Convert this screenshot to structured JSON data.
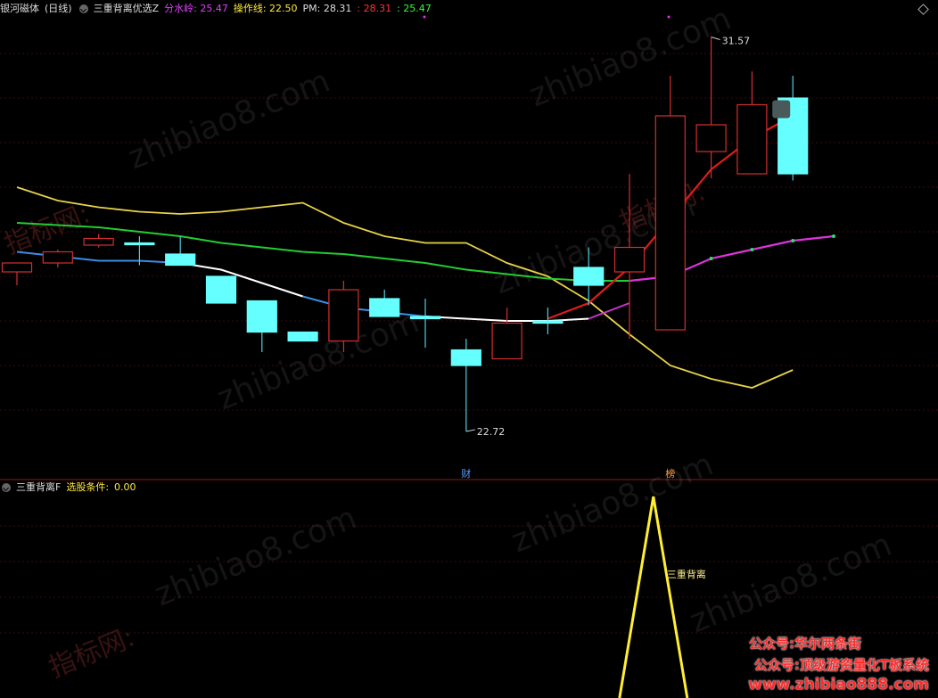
{
  "main_panel": {
    "stock_name": "银河磁体",
    "period": "(日线)",
    "indicator": "三重背离优选Z",
    "indicators": [
      {
        "label": "分水岭:",
        "value": "25.47",
        "color": "#e040fb"
      },
      {
        "label": "操作线:",
        "value": "22.50",
        "color": "#ffeb3b"
      },
      {
        "label": "PM:",
        "value": "28.31",
        "color": "#dddddd"
      },
      {
        "label": ":",
        "value": "28.31",
        "color": "#ff3333"
      },
      {
        "label": ":",
        "value": "25.47",
        "color": "#33ff33"
      }
    ],
    "high_label": "31.57",
    "low_label": "22.72",
    "marker_cai": "财",
    "marker_bang": "榜"
  },
  "sub_panel": {
    "indicator": "三重背离F",
    "condition_label": "选股条件:",
    "condition_value": "0.00",
    "signal_label": "三重背离"
  },
  "watermarks": {
    "site": "zhibiao8.com",
    "cn": "指标网:",
    "mid_glyph": "■"
  },
  "promos": {
    "line1": "公众号:华尔两条街",
    "line2": "公众号:顶级游资量化T板系统",
    "line3": "www.zhibiao888.com"
  },
  "colors": {
    "up": "#d32f2f",
    "down": "#4dd0e1",
    "down_fill": "#66ffff",
    "ma_yellow": "#e8d24a",
    "ma_green": "#22cc33",
    "ma_blue": "#3a8ee6",
    "grid": "#3a0a0a"
  },
  "chart_data": {
    "type": "candlestick",
    "candles": [
      {
        "o": 26.3,
        "h": 26.5,
        "l": 26.0,
        "c": 26.5,
        "up": true
      },
      {
        "o": 26.5,
        "h": 26.8,
        "l": 26.4,
        "c": 26.75,
        "up": true
      },
      {
        "o": 26.9,
        "h": 27.15,
        "l": 26.85,
        "c": 27.05,
        "up": true
      },
      {
        "o": 26.95,
        "h": 27.1,
        "l": 26.45,
        "c": 26.95,
        "up": false
      },
      {
        "o": 26.7,
        "h": 27.1,
        "l": 26.45,
        "c": 26.45,
        "up": false
      },
      {
        "o": 26.2,
        "h": 26.2,
        "l": 25.6,
        "c": 25.6,
        "up": false
      },
      {
        "o": 25.65,
        "h": 25.65,
        "l": 24.5,
        "c": 24.95,
        "up": false
      },
      {
        "o": 24.95,
        "h": 24.95,
        "l": 24.75,
        "c": 24.75,
        "up": false
      },
      {
        "o": 24.75,
        "h": 26.1,
        "l": 24.5,
        "c": 25.9,
        "up": true
      },
      {
        "o": 25.7,
        "h": 25.9,
        "l": 25.3,
        "c": 25.3,
        "up": false
      },
      {
        "o": 25.3,
        "h": 25.7,
        "l": 24.6,
        "c": 25.25,
        "up": false
      },
      {
        "o": 24.55,
        "h": 24.8,
        "l": 22.72,
        "c": 24.2,
        "up": false
      },
      {
        "o": 24.35,
        "h": 25.5,
        "l": 24.35,
        "c": 25.15,
        "up": true
      },
      {
        "o": 25.2,
        "h": 25.5,
        "l": 24.9,
        "c": 25.15,
        "up": false
      },
      {
        "o": 26.4,
        "h": 26.85,
        "l": 25.55,
        "c": 26.0,
        "up": false
      },
      {
        "o": 26.3,
        "h": 28.5,
        "l": 24.8,
        "c": 26.85,
        "up": true
      },
      {
        "o": 25.0,
        "h": 30.7,
        "l": 25.0,
        "c": 29.8,
        "up": true
      },
      {
        "o": 29.0,
        "h": 31.57,
        "l": 28.4,
        "c": 29.6,
        "up": true
      },
      {
        "o": 28.5,
        "h": 30.8,
        "l": 28.5,
        "c": 30.05,
        "up": true
      },
      {
        "o": 30.2,
        "h": 30.7,
        "l": 28.35,
        "c": 28.5,
        "up": false
      }
    ],
    "ma_yellow": [
      28.2,
      27.9,
      27.75,
      27.65,
      27.6,
      27.65,
      27.75,
      27.85,
      27.4,
      27.1,
      26.95,
      26.95,
      26.5,
      26.2,
      25.65,
      24.9,
      24.2,
      23.9,
      23.7,
      24.1
    ],
    "ma_green": [
      27.4,
      27.35,
      27.3,
      27.2,
      27.1,
      26.95,
      26.85,
      26.75,
      26.7,
      26.6,
      26.5,
      26.35,
      26.25,
      26.15,
      26.1,
      26.1
    ],
    "ma_blue": [
      26.75,
      26.65,
      26.55,
      26.55,
      26.5,
      26.35,
      26.05,
      25.75,
      25.5,
      25.4,
      25.3,
      25.25,
      25.2,
      25.2,
      25.25,
      25.6
    ],
    "red_line": [
      25.25,
      25.6,
      26.4,
      27.5,
      28.6,
      29.3,
      29.8
    ],
    "magenta_line": [
      26.1,
      26.2,
      26.6,
      26.8,
      27.0,
      27.1
    ],
    "signal": [
      0,
      0,
      0,
      0,
      0,
      0,
      0,
      0,
      0,
      0,
      0,
      0,
      0,
      0,
      0,
      0,
      1,
      0,
      0,
      0
    ]
  }
}
